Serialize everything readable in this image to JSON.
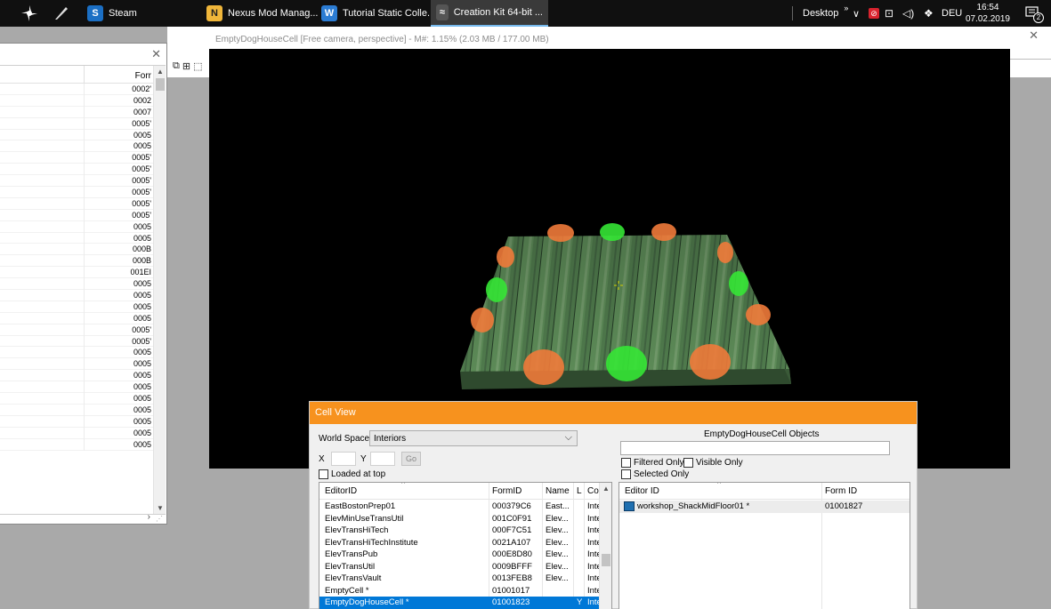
{
  "taskbar": {
    "pinned_icons": [
      "fan-app-icon",
      "feather-app-icon"
    ],
    "apps": [
      {
        "label": "Steam",
        "icon": "steam-icon",
        "color": "#1b6fc4",
        "active": false
      },
      {
        "label": "Nexus Mod Manag...",
        "icon": "nexus-icon",
        "color": "#f0b63a",
        "active": false
      },
      {
        "label": "Tutorial Static Colle...",
        "icon": "word-icon",
        "color": "#2b7cd3",
        "active": false
      },
      {
        "label": "Creation Kit 64-bit ...",
        "icon": "creation-kit-icon",
        "color": "#aaaaaa",
        "active": true
      }
    ],
    "desktop_label": "Desktop",
    "language": "DEU",
    "time": "16:54",
    "date": "07.02.2019",
    "notification_count": "2"
  },
  "object_window": {
    "column_header": "Forr",
    "form_ids": [
      "0002'",
      "0002",
      "0007",
      "0005'",
      "0005",
      "0005",
      "0005'",
      "0005'",
      "0005'",
      "0005'",
      "0005'",
      "0005'",
      "0005",
      "0005",
      "000B",
      "000B",
      "001EI",
      "0005",
      "0005",
      "0005",
      "0005",
      "0005'",
      "0005'",
      "0005",
      "0005",
      "0005",
      "0005",
      "0005",
      "0005",
      "0005",
      "0005",
      "0005"
    ]
  },
  "render_window": {
    "title": "EmptyDogHouseCell [Free camera, perspective] - M#: 1.15% (2.03 MB / 177.00 MB)"
  },
  "cell_view": {
    "title": "Cell View",
    "world_space_label": "World Space",
    "world_space_value": "Interiors",
    "x_label": "X",
    "y_label": "Y",
    "go_label": "Go",
    "loaded_at_top_label": "Loaded at top",
    "objects_title": "EmptyDogHouseCell Objects",
    "filtered_only_label": "Filtered Only",
    "visible_only_label": "Visible Only",
    "selected_only_label": "Selected Only",
    "cell_columns": [
      "EditorID",
      "FormID",
      "Name",
      "L",
      "Co"
    ],
    "cells": [
      {
        "editor_id": "EastBostonPrep01",
        "form_id": "000379C6",
        "name": "East...",
        "l": "",
        "co": "Inte"
      },
      {
        "editor_id": "ElevMinUseTransUtil",
        "form_id": "001C0F91",
        "name": "Elev...",
        "l": "",
        "co": "Inte"
      },
      {
        "editor_id": "ElevTransHiTech",
        "form_id": "000F7C51",
        "name": "Elev...",
        "l": "",
        "co": "Inte"
      },
      {
        "editor_id": "ElevTransHiTechInstitute",
        "form_id": "0021A107",
        "name": "Elev...",
        "l": "",
        "co": "Inte"
      },
      {
        "editor_id": "ElevTransPub",
        "form_id": "000E8D80",
        "name": "Elev...",
        "l": "",
        "co": "Inte"
      },
      {
        "editor_id": "ElevTransUtil",
        "form_id": "0009BFFF",
        "name": "Elev...",
        "l": "",
        "co": "Inte"
      },
      {
        "editor_id": "ElevTransVault",
        "form_id": "0013FEB8",
        "name": "Elev...",
        "l": "",
        "co": "Inte"
      },
      {
        "editor_id": "EmptyCell *",
        "form_id": "01001017",
        "name": "",
        "l": "",
        "co": "Inte"
      },
      {
        "editor_id": "EmptyDogHouseCell *",
        "form_id": "01001823",
        "name": "",
        "l": "Y",
        "co": "Inte"
      }
    ],
    "object_columns": [
      "Editor ID",
      "Form ID"
    ],
    "objects": [
      {
        "editor_id": "workshop_ShackMidFloor01 *",
        "form_id": "01001827",
        "icon": "static-object-icon"
      }
    ]
  },
  "colors": {
    "cell_view_accent": "#f7921e",
    "selection": "#0078d7",
    "viewport_background": "#000000",
    "green_marker": "#35e635",
    "orange_marker": "#f07a3a"
  }
}
